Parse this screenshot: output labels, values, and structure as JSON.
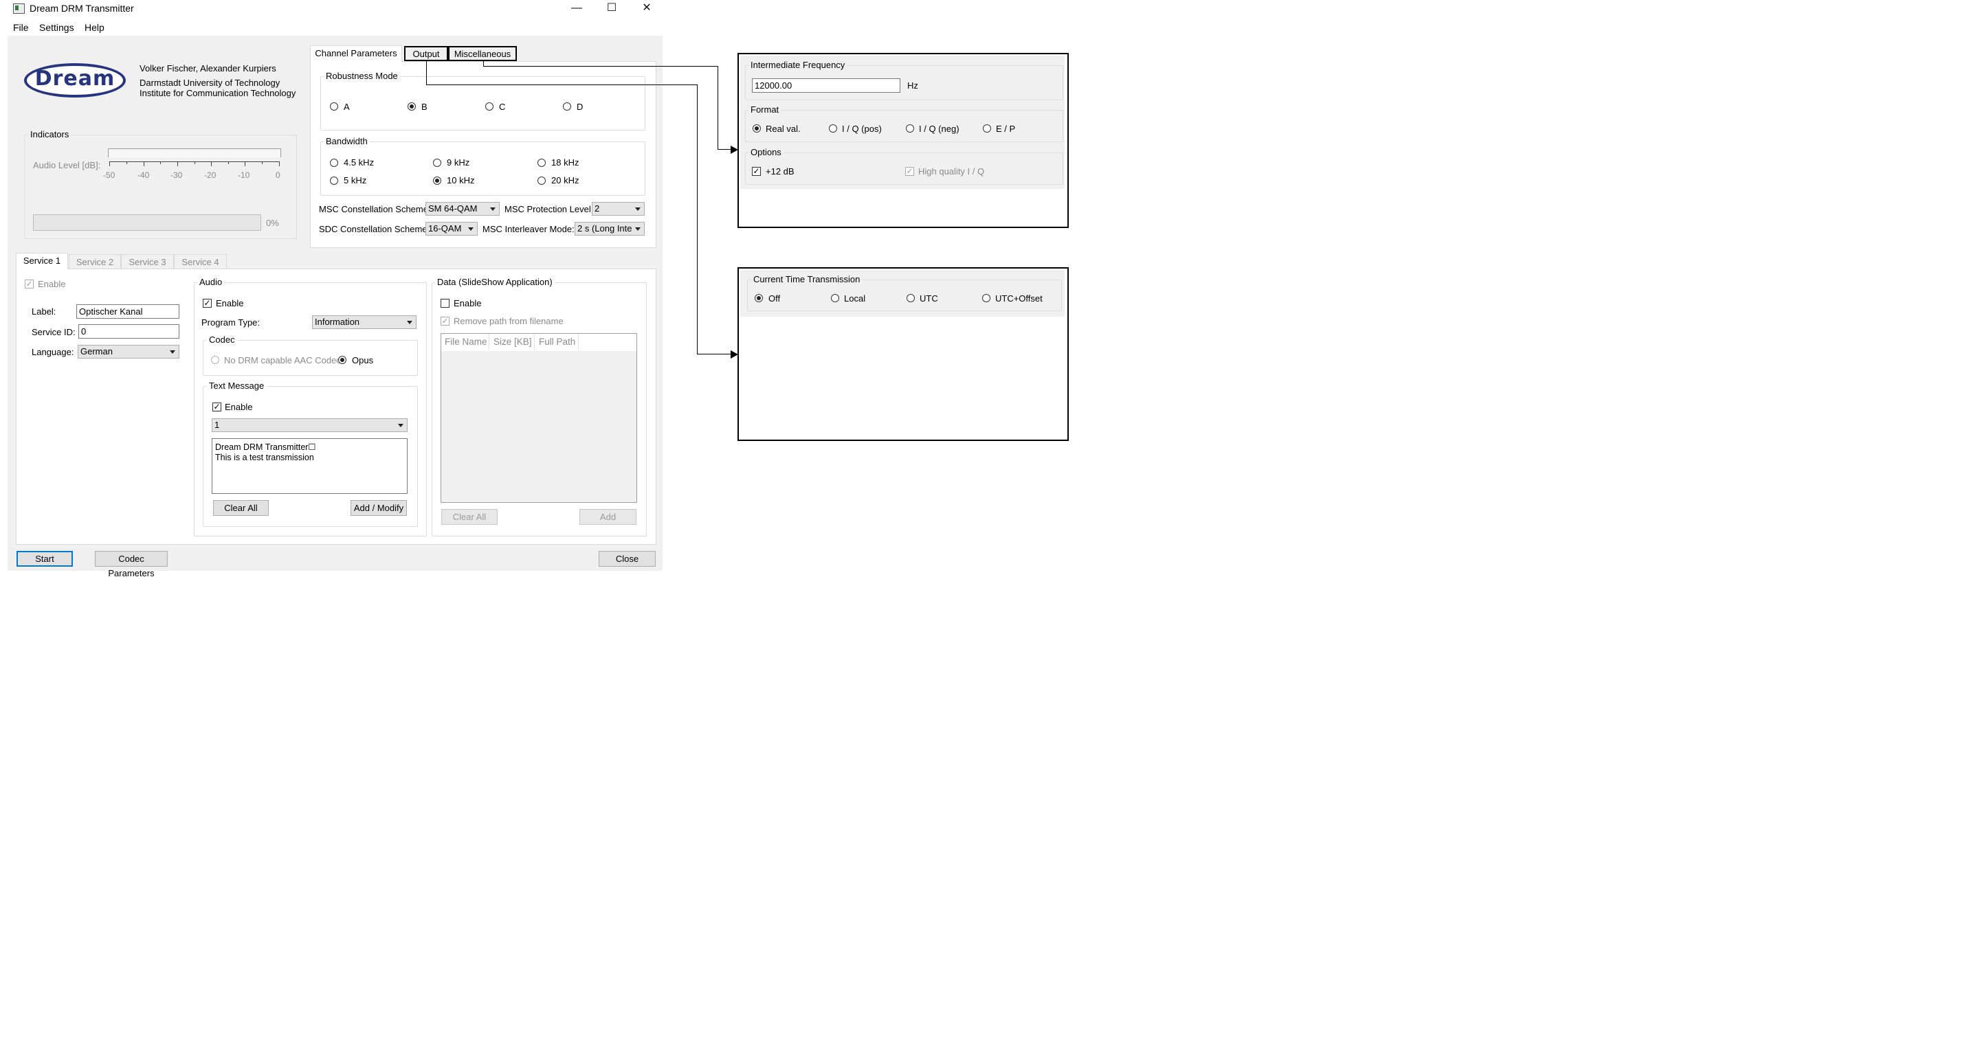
{
  "window": {
    "title": "Dream DRM Transmitter",
    "minimize": "—",
    "maximize": "☐",
    "close": "✕"
  },
  "menu": [
    "File",
    "Settings",
    "Help"
  ],
  "about": {
    "logo_text": "Dream",
    "authors": "Volker Fischer, Alexander Kurpiers",
    "university": "Darmstadt University of Technology",
    "institute": "Institute for Communication Technology"
  },
  "indicators": {
    "title": "Indicators",
    "audio_level_label": "Audio Level [dB]:",
    "scale": [
      "-50",
      "-40",
      "-30",
      "-20",
      "-10",
      "0"
    ],
    "progress_text": "0%",
    "progress": 0
  },
  "channel_tabs": [
    "Channel Parameters",
    "Output",
    "Miscellaneous"
  ],
  "robustness": {
    "title": "Robustness Mode",
    "options": [
      "A",
      "B",
      "C",
      "D"
    ],
    "selected": "B"
  },
  "bandwidth": {
    "title": "Bandwidth",
    "options": [
      "4.5 kHz",
      "9 kHz",
      "18 kHz",
      "5 kHz",
      "10 kHz",
      "20 kHz"
    ],
    "selected": "10 kHz"
  },
  "msc_constellation": {
    "label": "MSC Constellation Scheme:",
    "value": "SM 64-QAM"
  },
  "msc_protection": {
    "label": "MSC Protection Level:",
    "value": "2"
  },
  "sdc_constellation": {
    "label": "SDC Constellation Scheme:",
    "value": "16-QAM"
  },
  "msc_interleaver": {
    "label": "MSC Interleaver Mode:",
    "value": "2 s (Long Inte"
  },
  "service_tabs": [
    "Service 1",
    "Service 2",
    "Service 3",
    "Service 4"
  ],
  "service": {
    "enable_label": "Enable",
    "enabled": true,
    "label_label": "Label:",
    "label_value": "Optischer Kanal",
    "service_id_label": "Service ID:",
    "service_id_value": "0",
    "language_label": "Language:",
    "language_value": "German"
  },
  "audio": {
    "title": "Audio",
    "enable_label": "Enable",
    "enabled": true,
    "program_type_label": "Program Type:",
    "program_type_value": "Information",
    "codec_title": "Codec",
    "codec_options": [
      "No DRM capable AAC Codec",
      "Opus"
    ],
    "codec_selected": "Opus",
    "text_message_title": "Text Message",
    "text_enable_label": "Enable",
    "text_enabled": true,
    "message_index": "1",
    "message_lines": [
      "Dream DRM Transmitter☐",
      "This is a test transmission"
    ],
    "clear_all": "Clear All",
    "add_modify": "Add / Modify"
  },
  "data_app": {
    "title": "Data (SlideShow Application)",
    "enable_label": "Enable",
    "enabled": false,
    "remove_path_label": "Remove path from filename",
    "remove_path_checked": true,
    "columns": [
      "File Name",
      "Size [KB]",
      "Full Path"
    ],
    "clear_all": "Clear All",
    "add": "Add"
  },
  "bottom_buttons": {
    "start": "Start",
    "codec_parameters": "Codec Parameters",
    "close": "Close"
  },
  "output_panel": {
    "if_title": "Intermediate Frequency",
    "if_value": "12000.00",
    "if_unit": "Hz",
    "format_title": "Format",
    "format_options": [
      "Real val.",
      "I / Q (pos)",
      "I / Q (neg)",
      "E / P"
    ],
    "format_selected": "Real val.",
    "options_title": "Options",
    "plus12_label": "+12 dB",
    "plus12_checked": true,
    "hq_label": "High quality I / Q",
    "hq_checked": true
  },
  "misc_panel": {
    "ctt_title": "Current Time Transmission",
    "options": [
      "Off",
      "Local",
      "UTC",
      "UTC+Offset"
    ],
    "selected": "Off"
  }
}
